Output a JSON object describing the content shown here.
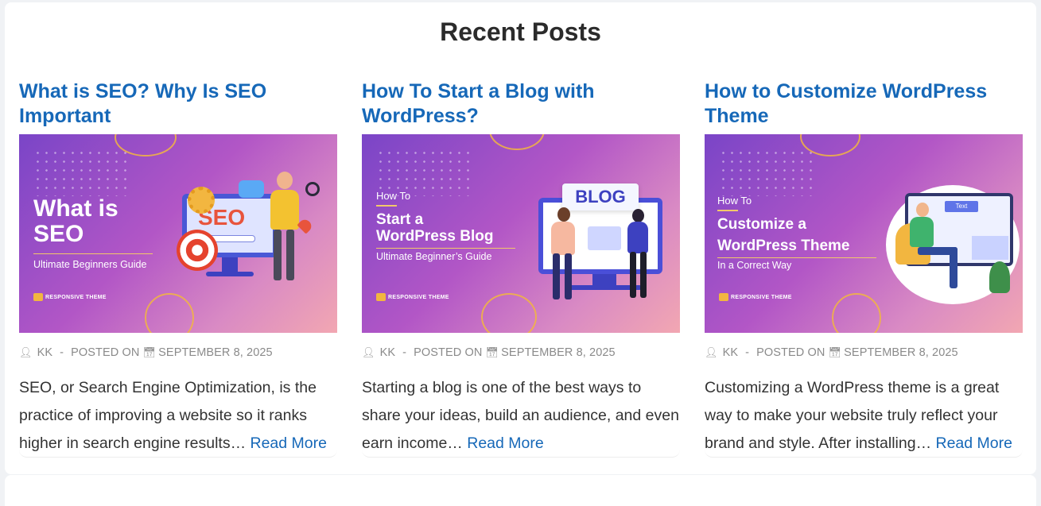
{
  "section": {
    "title": "Recent Posts"
  },
  "posts": [
    {
      "title": "What is SEO? Why Is SEO Important",
      "image": {
        "headline": "What is SEO",
        "subtitle": "Ultimate Beginners Guide",
        "art_label": "SEO",
        "brand": "RESPONSIVE THEME"
      },
      "meta": {
        "author": "KK",
        "separator": "-",
        "posted_on": "POSTED ON",
        "date": "SEPTEMBER 8, 2025"
      },
      "excerpt": "SEO, or Search Engine Optimization, is the practice of improving a website so it ranks higher in search engine results…",
      "read_more": "Read More"
    },
    {
      "title": "How To Start a Blog with WordPress?",
      "image": {
        "kicker": "How To",
        "headline_line1": "Start a",
        "headline_line2": "WordPress Blog",
        "subtitle": "Ultimate Beginner’s Guide",
        "art_label": "BLOG",
        "brand": "RESPONSIVE THEME"
      },
      "meta": {
        "author": "KK",
        "separator": "-",
        "posted_on": "POSTED ON",
        "date": "SEPTEMBER 8, 2025"
      },
      "excerpt": "Starting a blog is one of the best ways to share your ideas, build an audience, and even earn income…",
      "read_more": "Read More"
    },
    {
      "title": "How to Customize WordPress Theme",
      "image": {
        "kicker": "How To",
        "headline_line1": "Customize a",
        "headline_line2": "WordPress Theme",
        "subtitle": "In a Correct Way",
        "art_label": "Text",
        "brand": "RESPONSIVE THEME"
      },
      "meta": {
        "author": "KK",
        "separator": "-",
        "posted_on": "POSTED ON",
        "date": "SEPTEMBER 8, 2025"
      },
      "excerpt": "Customizing a WordPress theme is a great way to make your website truly reflect your brand and style. After installing…",
      "read_more": "Read More"
    }
  ],
  "icons": {
    "author": "user-icon",
    "date": "calendar-icon"
  },
  "colors": {
    "link": "#1668b8",
    "heading": "#2b2b2b",
    "meta": "#8a8a8a",
    "thumb_gradient_start": "#7a45c7",
    "thumb_gradient_end": "#f2a7b2"
  }
}
